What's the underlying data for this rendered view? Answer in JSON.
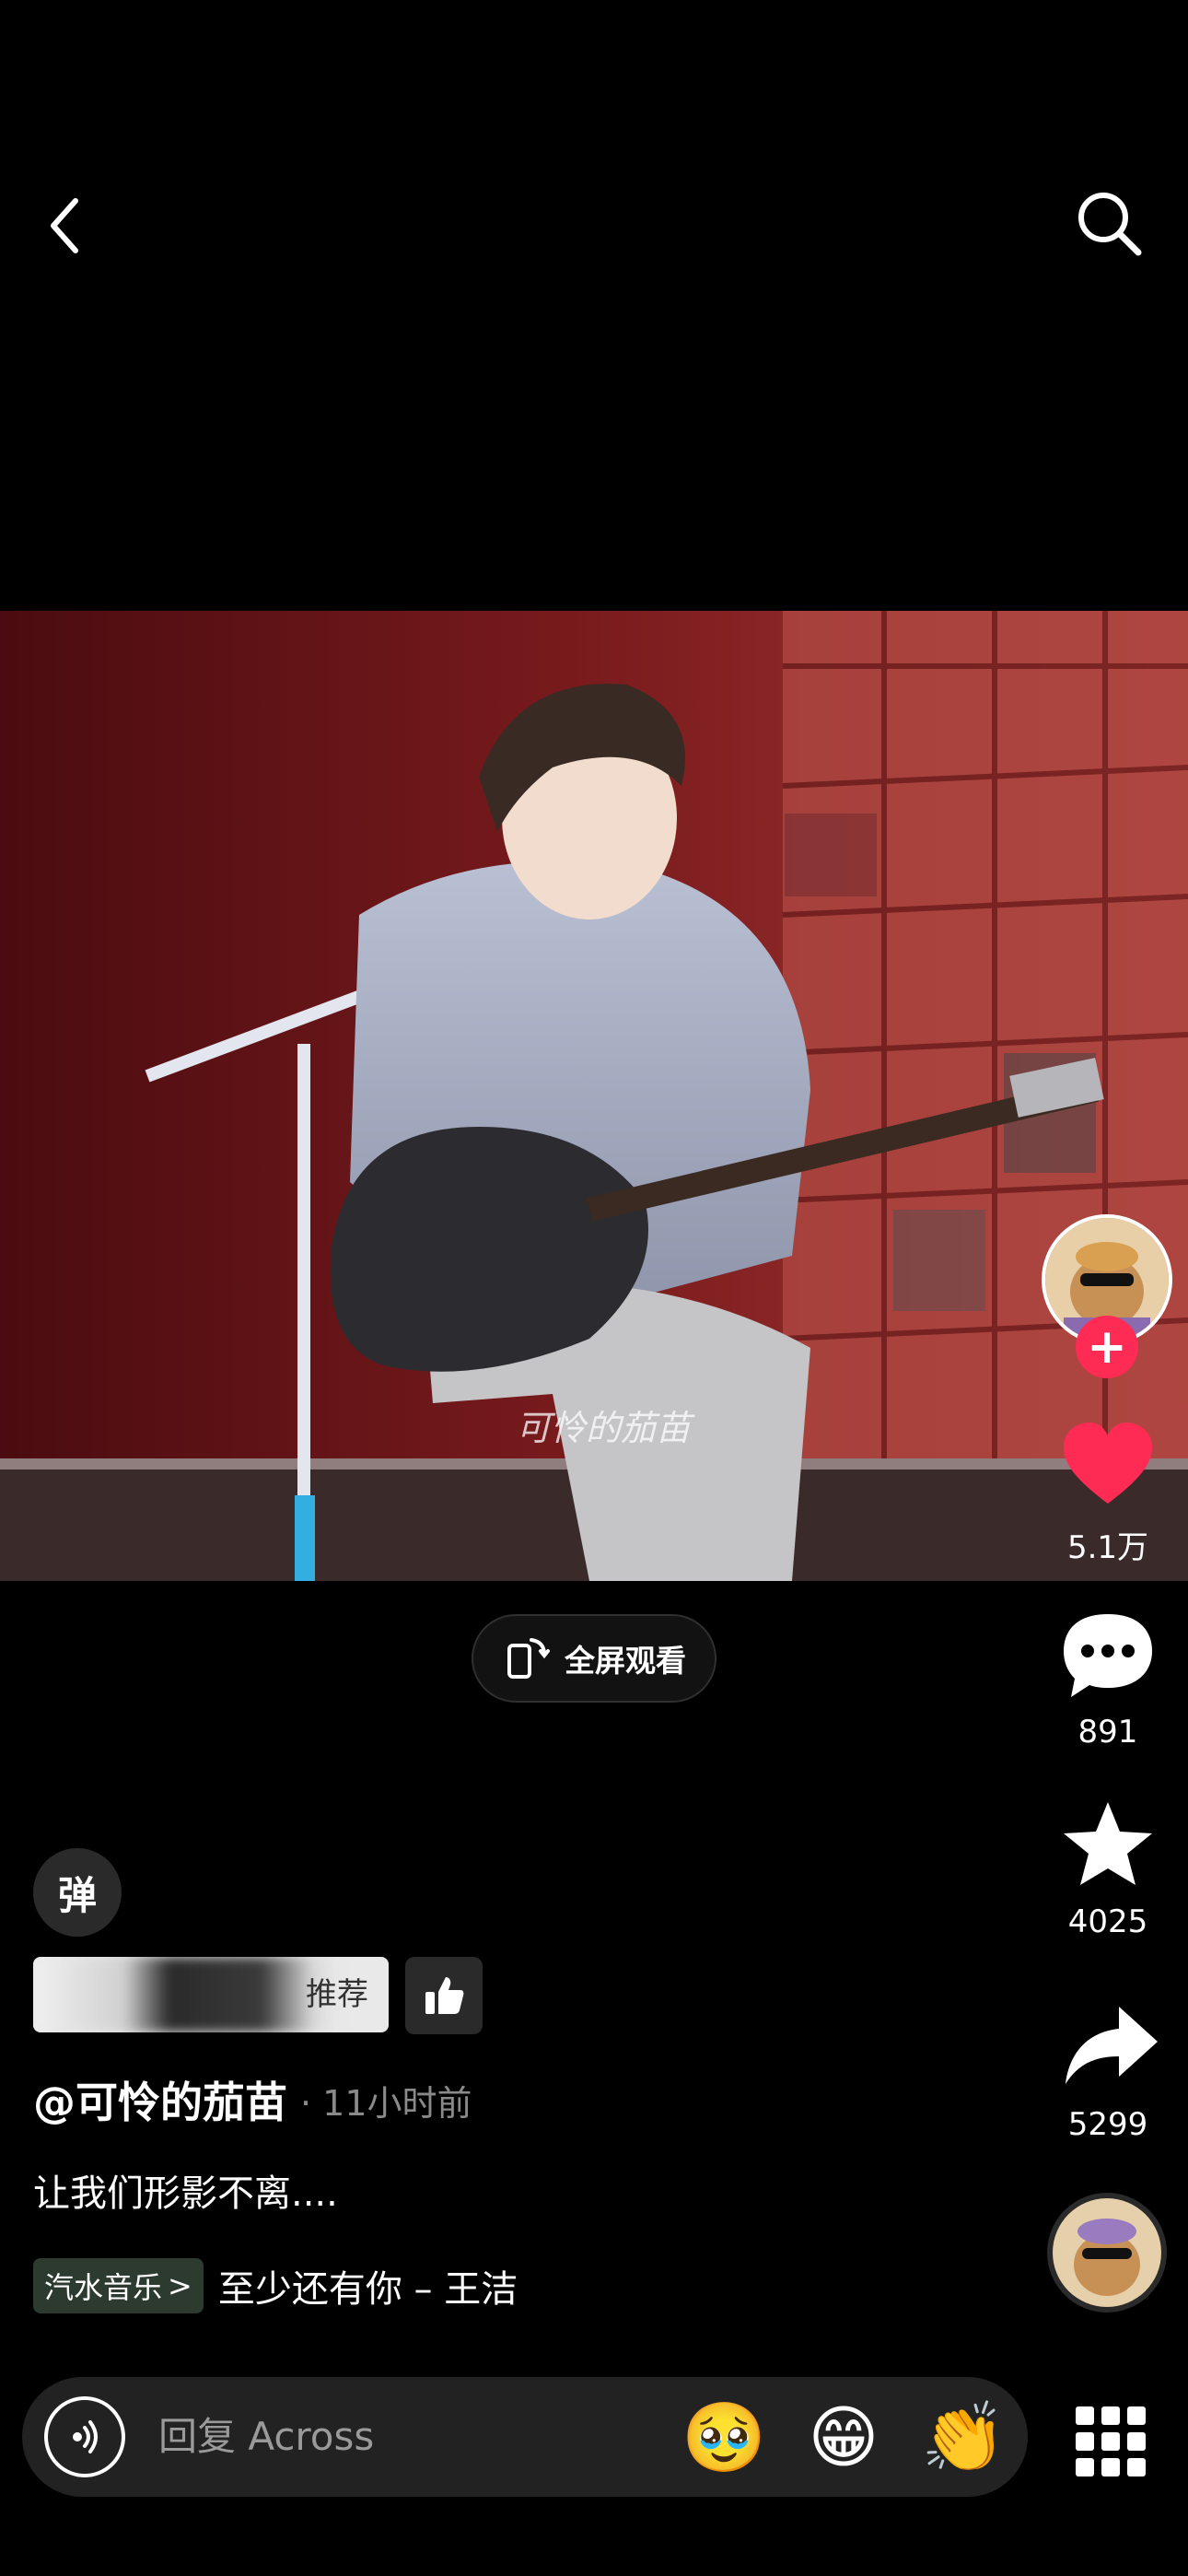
{
  "nav": {
    "back_icon": "chevron-left-icon",
    "search_icon": "search-icon"
  },
  "video": {
    "watermark": "可怜的茄苗"
  },
  "fullscreen": {
    "label": "全屏观看",
    "icon": "rotate-phone-icon"
  },
  "rail": {
    "likes": "5.1万",
    "comments": "891",
    "favorites": "4025",
    "shares": "5299",
    "like_color": "#fe2c55",
    "follow_symbol": "+"
  },
  "danmaku": {
    "label": "弹"
  },
  "recommend": {
    "label": "推荐"
  },
  "author": {
    "name": "@可怜的茄苗",
    "time": "· 11小时前"
  },
  "caption": "让我们形影不离....",
  "music": {
    "tag": "汽水音乐",
    "tag_arrow": ">",
    "title": "至少还有你 – 王洁"
  },
  "reply": {
    "placeholder": "回复 Across",
    "emojis": [
      "🥹",
      "😁",
      "👏"
    ]
  }
}
